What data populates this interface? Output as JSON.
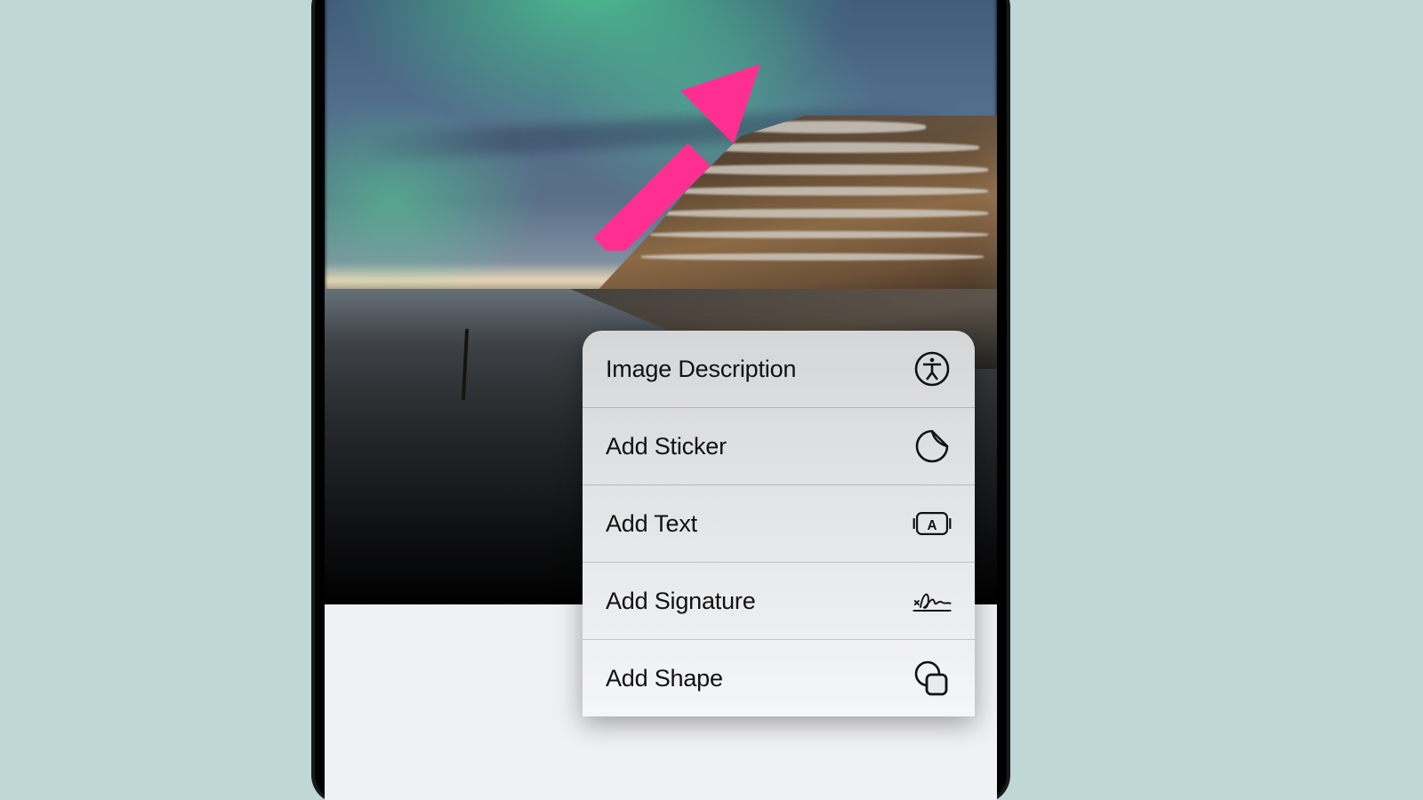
{
  "annotation": {
    "arrow_color": "#ff2f92"
  },
  "menu": {
    "items": [
      {
        "label": "Image Description",
        "icon": "accessibility-icon"
      },
      {
        "label": "Add Sticker",
        "icon": "sticker-icon"
      },
      {
        "label": "Add Text",
        "icon": "text-box-icon"
      },
      {
        "label": "Add Signature",
        "icon": "signature-icon"
      },
      {
        "label": "Add Shape",
        "icon": "shapes-icon"
      }
    ]
  }
}
